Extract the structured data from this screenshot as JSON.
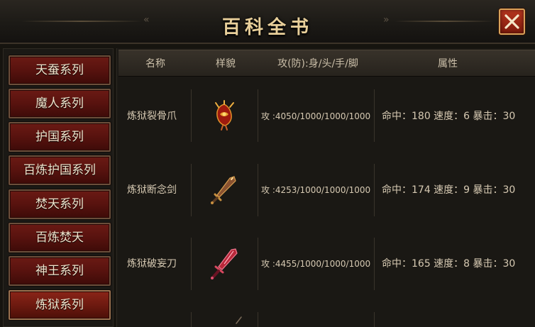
{
  "window": {
    "title": "百科全书"
  },
  "sidebar": {
    "items": [
      {
        "label": "天蚕系列",
        "active": false
      },
      {
        "label": "魔人系列",
        "active": false
      },
      {
        "label": "护国系列",
        "active": false
      },
      {
        "label": "百炼护国系列",
        "active": false
      },
      {
        "label": "焚天系列",
        "active": false
      },
      {
        "label": "百炼焚天",
        "active": false
      },
      {
        "label": "神王系列",
        "active": false
      },
      {
        "label": "炼狱系列",
        "active": true
      }
    ]
  },
  "table": {
    "headers": {
      "name": "名称",
      "appearance": "样貌",
      "attack": "攻(防):身/头/手/脚",
      "attributes": "属性"
    },
    "rows": [
      {
        "name": "炼狱裂骨爪",
        "icon": "claw-weapon-icon",
        "attack": "攻 :4050/1000/1000/1000",
        "attributes": "命中：180 速度：6 暴击：30"
      },
      {
        "name": "炼狱断念剑",
        "icon": "sword-weapon-icon",
        "attack": "攻 :4253/1000/1000/1000",
        "attributes": "命中：174 速度：9 暴击：30"
      },
      {
        "name": "炼狱破妄刀",
        "icon": "blade-weapon-icon",
        "attack": "攻 :4455/1000/1000/1000",
        "attributes": "命中：165 速度：8 暴击：30"
      }
    ]
  },
  "colors": {
    "title": "#e8cf9a",
    "button_red": "#5a130f",
    "button_border": "#6a4e3a",
    "text": "#d6c9b2",
    "close_red": "#b8361e"
  }
}
